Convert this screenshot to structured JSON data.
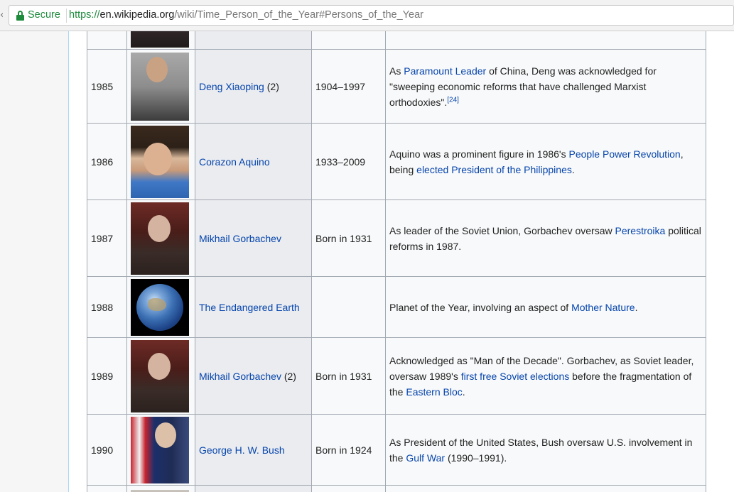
{
  "browser": {
    "secure_label": "Secure",
    "url_scheme": "https://",
    "url_host": "en.wikipedia.org",
    "url_path": "/wiki/Time_Person_of_the_Year#Persons_of_the_Year"
  },
  "rows": [
    {
      "year": "1985",
      "name": "Deng Xiaoping",
      "name_suffix": " (2)",
      "life": "1904–1997",
      "note": [
        "As ",
        "Paramount Leader",
        " of China, Deng was acknowledged for \"sweeping economic reforms that have challenged Marxist orthodoxies\".",
        "[24]"
      ]
    },
    {
      "year": "1986",
      "name": "Corazon Aquino",
      "life": "1933–2009",
      "note": [
        "Aquino was a prominent figure in 1986's ",
        "People Power Revolution",
        ", being ",
        "elected President of the Philippines",
        "."
      ]
    },
    {
      "year": "1987",
      "name": "Mikhail Gorbachev",
      "life": "Born in 1931",
      "note": [
        "As leader of the Soviet Union, Gorbachev oversaw ",
        "Perestroika",
        " political reforms in 1987."
      ]
    },
    {
      "year": "1988",
      "name": "The Endangered Earth",
      "life": "",
      "note": [
        "Planet of the Year, involving an aspect of ",
        "Mother Nature",
        "."
      ]
    },
    {
      "year": "1989",
      "name": "Mikhail Gorbachev",
      "name_suffix": " (2)",
      "life": "Born in 1931",
      "note": [
        "Acknowledged as \"Man of the Decade\". Gorbachev, as Soviet leader, oversaw 1989's ",
        "first free Soviet elections",
        " before the fragmentation of the ",
        "Eastern Bloc",
        "."
      ]
    },
    {
      "year": "1990",
      "name": "George H. W. Bush",
      "life": "Born in 1924",
      "note": [
        "As President of the United States, Bush oversaw U.S. involvement in the ",
        "Gulf War",
        " (1990–1991)."
      ]
    }
  ]
}
